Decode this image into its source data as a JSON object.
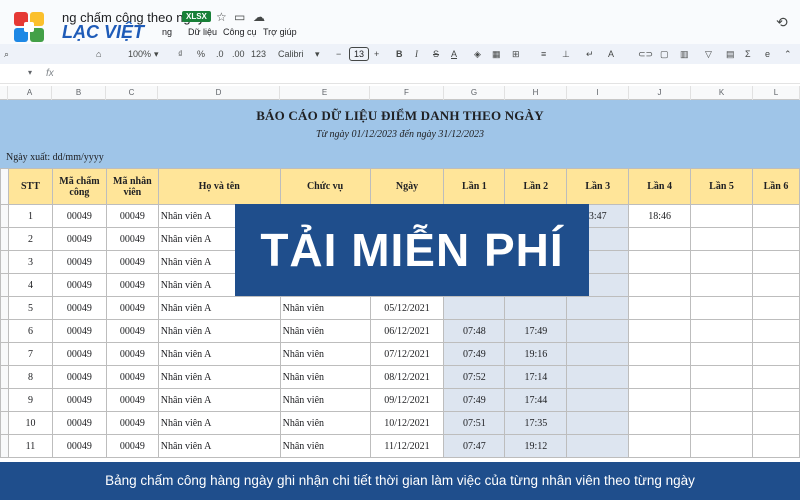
{
  "app": {
    "doc_title": "ng chấm công theo ngày",
    "file_badge": "XLSX",
    "brand": "LẠC VIỆT",
    "menu": [
      "ng",
      "Dữ liệu",
      "Công cụ",
      "Trợ giúp"
    ]
  },
  "toolbar": {
    "zoom": "100%",
    "currency": "₫",
    "percent": "%",
    "dec_less": ".0",
    "dec_more": ".00",
    "number_format": "123",
    "font_family": "Calibri",
    "font_size": "13",
    "bold": "B",
    "italic": "I",
    "strike": "S",
    "text_color": "A"
  },
  "formula_bar": {
    "cell_ref": "",
    "fx": "fx"
  },
  "columns": [
    "A",
    "B",
    "C",
    "D",
    "E",
    "F",
    "G",
    "H",
    "I",
    "J",
    "K",
    "L"
  ],
  "report": {
    "title": "BÁO CÁO DỮ LIỆU ĐIỂM DANH THEO NGÀY",
    "range": "Từ ngày 01/12/2023 đến ngày 31/12/2023",
    "export_date": "Ngày xuất: dd/mm/yyyy"
  },
  "table": {
    "headers": [
      "STT",
      "Mã chấm công",
      "Mã nhân viên",
      "Họ và tên",
      "Chức vụ",
      "Ngày",
      "Lần 1",
      "Lần 2",
      "Lần 3",
      "Lần 4",
      "Lần 5",
      "Lần 6"
    ],
    "rows": [
      [
        "1",
        "00049",
        "00049",
        "Nhân viên A",
        "",
        "",
        "",
        "",
        "3:47",
        "18:46",
        "",
        ""
      ],
      [
        "2",
        "00049",
        "00049",
        "Nhân viên A",
        "",
        "",
        "",
        "",
        "",
        "",
        "",
        ""
      ],
      [
        "3",
        "00049",
        "00049",
        "Nhân viên A",
        "",
        "",
        "",
        "",
        "",
        "",
        "",
        ""
      ],
      [
        "4",
        "00049",
        "00049",
        "Nhân viên A",
        "",
        "",
        "",
        "",
        "",
        "",
        "",
        ""
      ],
      [
        "5",
        "00049",
        "00049",
        "Nhân viên A",
        "Nhân viên",
        "05/12/2021",
        "",
        "",
        "",
        "",
        "",
        ""
      ],
      [
        "6",
        "00049",
        "00049",
        "Nhân viên A",
        "Nhân viên",
        "06/12/2021",
        "07:48",
        "17:49",
        "",
        "",
        "",
        ""
      ],
      [
        "7",
        "00049",
        "00049",
        "Nhân viên A",
        "Nhân viên",
        "07/12/2021",
        "07:49",
        "19:16",
        "",
        "",
        "",
        ""
      ],
      [
        "8",
        "00049",
        "00049",
        "Nhân viên A",
        "Nhân viên",
        "08/12/2021",
        "07:52",
        "17:14",
        "",
        "",
        "",
        ""
      ],
      [
        "9",
        "00049",
        "00049",
        "Nhân viên A",
        "Nhân viên",
        "09/12/2021",
        "07:49",
        "17:44",
        "",
        "",
        "",
        ""
      ],
      [
        "10",
        "00049",
        "00049",
        "Nhân viên A",
        "Nhân viên",
        "10/12/2021",
        "07:51",
        "17:35",
        "",
        "",
        "",
        ""
      ],
      [
        "11",
        "00049",
        "00049",
        "Nhân viên A",
        "Nhân viên",
        "11/12/2021",
        "07:47",
        "19:12",
        "",
        "",
        "",
        ""
      ]
    ]
  },
  "promo": {
    "text": "TẢI MIỄN PHÍ"
  },
  "caption": {
    "text": "Bảng chấm công hàng ngày ghi nhận chi tiết thời gian làm việc của từng nhân viên theo từng ngày"
  },
  "colors": {
    "header_band": "#9fc5e8",
    "table_header": "#ffe599",
    "shaded_cells": "#dde5f0",
    "promo_bg": "#1f4e8c",
    "xlsx_badge": "#188038"
  }
}
